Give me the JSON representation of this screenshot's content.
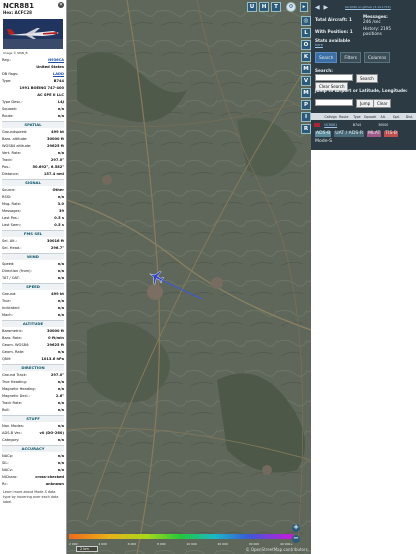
{
  "info": {
    "callsign": "NCR881",
    "hex_line": "Hex: ACFC28",
    "close": "✕",
    "photo_credit": "Image © NNN_B",
    "rows_top": [
      {
        "label": "Reg.:",
        "value": "N936CA",
        "link": true
      },
      {
        "label": "",
        "value": "United States",
        "link": false
      },
      {
        "label": "DB flags:",
        "value": "LADD",
        "link": true
      },
      {
        "label": "Type:",
        "value": "B744",
        "link": false
      },
      {
        "label": "",
        "value": "1991 BOEING 747-400",
        "link": false
      },
      {
        "label": "",
        "value": "AC SPE II LLC",
        "link": false
      },
      {
        "label": "Type Desc.:",
        "value": "L4J",
        "link": false
      },
      {
        "label": "Squawk:",
        "value": "n/a",
        "link": false
      },
      {
        "label": "Route:",
        "value": "n/a",
        "link": false
      }
    ],
    "sections": [
      {
        "title": "SPATIAL",
        "rows": [
          {
            "label": "Groundspeed:",
            "value": "499 kt"
          },
          {
            "label": "Baro. altitude:",
            "value": "30000 ft"
          },
          {
            "label": "WGS84 altitude:",
            "value": "29625 ft"
          },
          {
            "label": "Vert. Rate:",
            "value": "n/a"
          },
          {
            "label": "Track:",
            "value": "297.0°"
          },
          {
            "label": "Pos.:",
            "value": "50.692°, 6.582°"
          },
          {
            "label": "Distance:",
            "value": "157.4 nmi"
          }
        ]
      },
      {
        "title": "SIGNAL",
        "rows": [
          {
            "label": "Source:",
            "value": "Other"
          },
          {
            "label": "RSSI:",
            "value": "n/a"
          },
          {
            "label": "Msg. Rate:",
            "value": "3.0"
          },
          {
            "label": "Messages:",
            "value": "39"
          },
          {
            "label": "Last Pos.:",
            "value": "0.5 s"
          },
          {
            "label": "Last Seen:",
            "value": "0.5 s"
          }
        ]
      },
      {
        "title": "FMS SEL",
        "rows": [
          {
            "label": "Sel. Alt.:",
            "value": "30016 ft"
          },
          {
            "label": "Sel. Head.:",
            "value": "296.7°"
          }
        ]
      },
      {
        "title": "WIND",
        "rows": [
          {
            "label": "Speed:",
            "value": "n/a"
          },
          {
            "label": "Direction (from):",
            "value": "n/a"
          },
          {
            "label": "TAT / OAT:",
            "value": "n/a"
          }
        ]
      },
      {
        "title": "SPEED",
        "rows": [
          {
            "label": "Ground:",
            "value": "499 kt"
          },
          {
            "label": "True:",
            "value": "n/a"
          },
          {
            "label": "Indicated:",
            "value": "n/a"
          },
          {
            "label": "Mach:",
            "value": "n/a"
          }
        ]
      },
      {
        "title": "ALTITUDE",
        "rows": [
          {
            "label": "Barometric:",
            "value": "30000 ft"
          },
          {
            "label": "Baro. Rate:",
            "value": "0 ft/min"
          },
          {
            "label": "Geom. WGS84:",
            "value": "29625 ft"
          },
          {
            "label": "Geom. Rate:",
            "value": "n/a"
          },
          {
            "label": "QNH:",
            "value": "1013.6 hPa"
          }
        ]
      },
      {
        "title": "DIRECTION",
        "rows": [
          {
            "label": "Ground Track:",
            "value": "297.0°"
          },
          {
            "label": "True Heading:",
            "value": "n/a"
          },
          {
            "label": "Magnetic Heading:",
            "value": "n/a"
          },
          {
            "label": "Magnetic Decl.:",
            "value": "2.6°"
          },
          {
            "label": "Track Rate:",
            "value": "n/a"
          },
          {
            "label": "Roll:",
            "value": "n/a"
          }
        ]
      },
      {
        "title": "STUFF",
        "rows": [
          {
            "label": "Nav. Modes:",
            "value": "n/a"
          },
          {
            "label": "ADS-B Ver.:",
            "value": "v0 (DO-260)"
          },
          {
            "label": "Category:",
            "value": "n/a"
          }
        ]
      },
      {
        "title": "ACCURACY",
        "rows": [
          {
            "label": "NACp:",
            "value": "n/a"
          },
          {
            "label": "SIL:",
            "value": "n/a"
          },
          {
            "label": "NACv:",
            "value": "n/a"
          },
          {
            "label": "NICbaro:",
            "value": "cross-checked"
          },
          {
            "label": "Rc:",
            "value": "unknown"
          }
        ]
      }
    ],
    "footnote": "Learn more about Mode S data type by hovering over each data label."
  },
  "map": {
    "buttons": [
      {
        "key": "U",
        "name": "map-button-u"
      },
      {
        "key": "H",
        "name": "map-button-h"
      },
      {
        "key": "T",
        "name": "map-button-t"
      }
    ],
    "side_buttons": [
      {
        "key": "◎",
        "name": "map-button-center"
      },
      {
        "key": "L",
        "name": "map-button-l"
      },
      {
        "key": "O",
        "name": "map-button-o"
      },
      {
        "key": "K",
        "name": "map-button-k"
      },
      {
        "key": "M",
        "name": "map-button-m"
      },
      {
        "key": "V",
        "name": "map-button-v"
      },
      {
        "key": "M",
        "name": "map-button-m2"
      },
      {
        "key": "P",
        "name": "map-button-p"
      },
      {
        "key": "I",
        "name": "map-button-i"
      },
      {
        "key": "R",
        "name": "map-button-r"
      }
    ],
    "alt_ticks": [
      "2 000",
      "4 000",
      "6 000",
      "8 000",
      "10 000",
      "20 000",
      "30 000",
      "40 000+"
    ],
    "scale": "2 km",
    "attribution": "© OpenStreetMap contributors.",
    "zoom_in": "+",
    "zoom_out": "−",
    "track_color": "#3b5bd6",
    "plane_color": "#2e45c8"
  },
  "side": {
    "toggle": "◀ ▶",
    "top_link": "tar1090 on github (3.14.1715)",
    "stats": {
      "total_aircraft": "Total Aircraft: 1",
      "with_position": "With Position: 1",
      "messages": "Messages:",
      "messages_rate": "246 /sec",
      "history": "History: 2195",
      "history_unit": "positions",
      "stats_available": "Stats available",
      "stats_link": "here"
    },
    "tabs": [
      "Search",
      "Filters",
      "Columns"
    ],
    "search_label": "Search:",
    "search_button": "Search",
    "clear_search": "Clear Search",
    "jump_label": "Jump to Airport or Latitude, Longitude:",
    "jump_button": "Jump",
    "clear_button": "Clear",
    "headers": [
      "Callsign",
      "Route",
      "Type",
      "Squawk",
      "Alt.",
      "Spd.",
      "Dist."
    ],
    "row": {
      "callsign": "NCR881",
      "type": "B744",
      "alt": "30000"
    },
    "badges": [
      {
        "text": "ADS-B",
        "bg": "#5a8a9a"
      },
      {
        "text": "UAT / ADS-R",
        "bg": "#4a6a7a"
      },
      {
        "text": "MLAT",
        "bg": "#a05a8a"
      },
      {
        "text": "TIS-B",
        "bg": "#c05050"
      }
    ],
    "modes": "Mode-S"
  }
}
